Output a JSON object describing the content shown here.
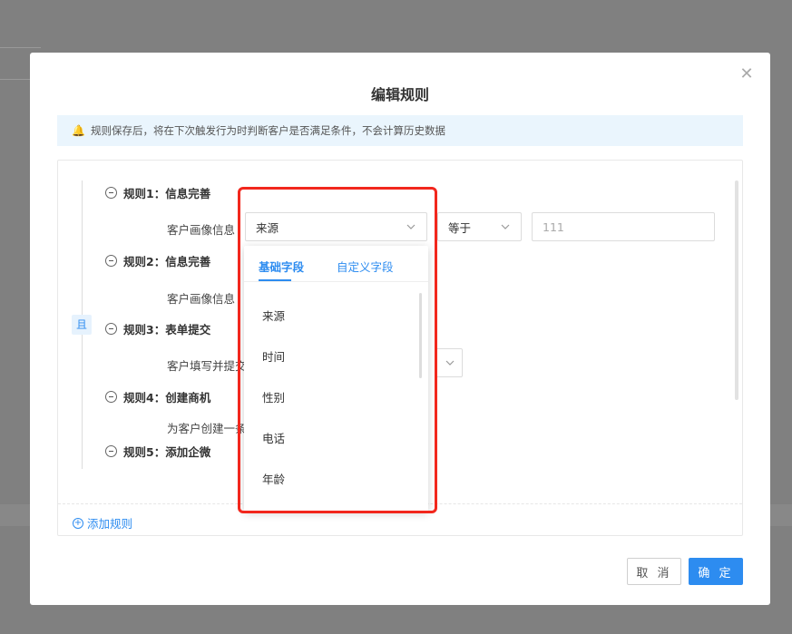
{
  "dialog": {
    "title": "编辑规则",
    "close_icon": "close-icon",
    "notice": "规则保存后，将在下次触发行为时判断客户是否满足条件，不会计算历史数据",
    "and_label": "且",
    "add_rule_label": "添加规则",
    "cancel_label": "取 消",
    "confirm_label": "确 定"
  },
  "rules": [
    {
      "title": "规则1：信息完善",
      "field_label": "客户画像信息",
      "field_value": "来源",
      "operator": "等于",
      "value_placeholder": "111"
    },
    {
      "title": "规则2：信息完善",
      "field_label": "客户画像信息"
    },
    {
      "title": "规则3：表单提交",
      "field_label": "客户填写并提交"
    },
    {
      "title": "规则4：创建商机",
      "field_label": "为客户创建一条"
    },
    {
      "title": "规则5：添加企微"
    }
  ],
  "dropdown": {
    "tabs": [
      "基础字段",
      "自定义字段"
    ],
    "items": [
      "来源",
      "时间",
      "性别",
      "电话",
      "年龄"
    ]
  },
  "colors": {
    "accent": "#2d8cf0",
    "highlight": "#f2271d"
  }
}
